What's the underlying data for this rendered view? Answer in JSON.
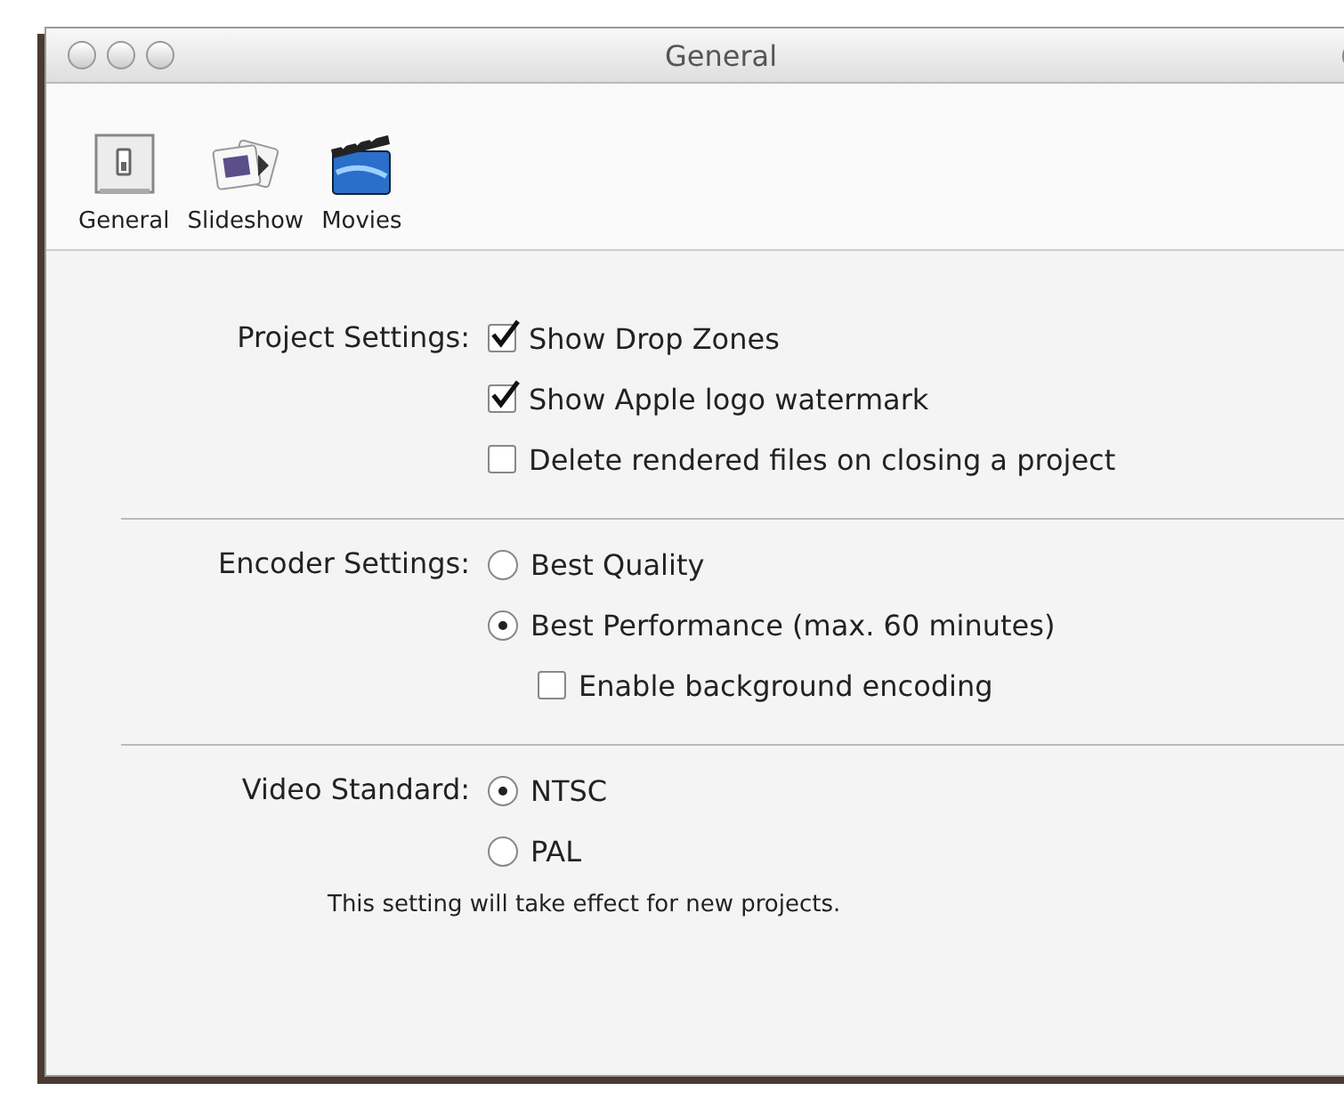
{
  "window": {
    "title": "General"
  },
  "toolbar": {
    "items": [
      {
        "kind": "general",
        "label": "General"
      },
      {
        "kind": "slideshow",
        "label": "Slideshow"
      },
      {
        "kind": "movies",
        "label": "Movies"
      }
    ]
  },
  "sections": [
    {
      "label": "Project Settings:",
      "options": [
        {
          "kind": "checkbox",
          "label": "Show Drop Zones",
          "checked": true
        },
        {
          "kind": "checkbox",
          "label": "Show Apple logo watermark",
          "checked": true
        },
        {
          "kind": "checkbox",
          "label": "Delete rendered files on closing a project",
          "checked": false
        }
      ]
    },
    {
      "label": "Encoder Settings:",
      "options": [
        {
          "kind": "radio",
          "label": "Best Quality",
          "selected": false
        },
        {
          "kind": "radio",
          "label": "Best Performance (max. 60 minutes)",
          "selected": true,
          "children": [
            {
              "kind": "checkbox",
              "label": "Enable background encoding",
              "checked": false
            }
          ]
        }
      ]
    },
    {
      "label": "Video Standard:",
      "options": [
        {
          "kind": "radio",
          "label": "NTSC",
          "selected": true
        },
        {
          "kind": "radio",
          "label": "PAL",
          "selected": false
        }
      ],
      "note": "This setting will take effect for new projects."
    }
  ]
}
